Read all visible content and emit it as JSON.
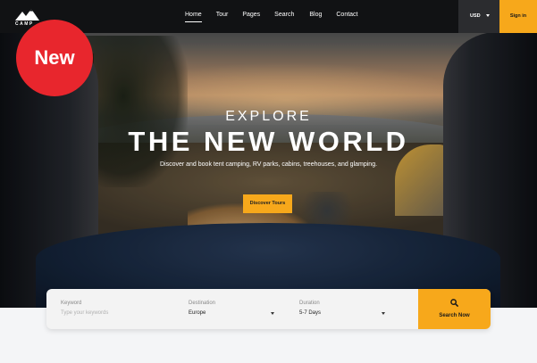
{
  "brand": {
    "name": "CAMP"
  },
  "nav": {
    "items": [
      {
        "label": "Home",
        "active": true
      },
      {
        "label": "Tour"
      },
      {
        "label": "Pages"
      },
      {
        "label": "Search"
      },
      {
        "label": "Blog"
      },
      {
        "label": "Contact"
      }
    ]
  },
  "currency": {
    "label": "USD"
  },
  "signin": {
    "label": "Sign in"
  },
  "badge": {
    "label": "New"
  },
  "hero": {
    "eyebrow": "EXPLORE",
    "headline": "THE NEW WORLD",
    "subline": "Discover and book tent camping, RV parks, cabins, treehouses, and glamping.",
    "cta": "Discover Tours"
  },
  "search": {
    "keyword": {
      "label": "Keyword",
      "placeholder": "Type your keywords"
    },
    "destination": {
      "label": "Destination",
      "value": "Europe"
    },
    "duration": {
      "label": "Duration",
      "value": "5-7 Days"
    },
    "button": "Search Now"
  },
  "colors": {
    "accent": "#f7a81b",
    "badge": "#e8262d",
    "topbar": "#111214"
  },
  "icons": [
    "mountain-logo-icon",
    "caret-down-icon",
    "search-icon"
  ]
}
